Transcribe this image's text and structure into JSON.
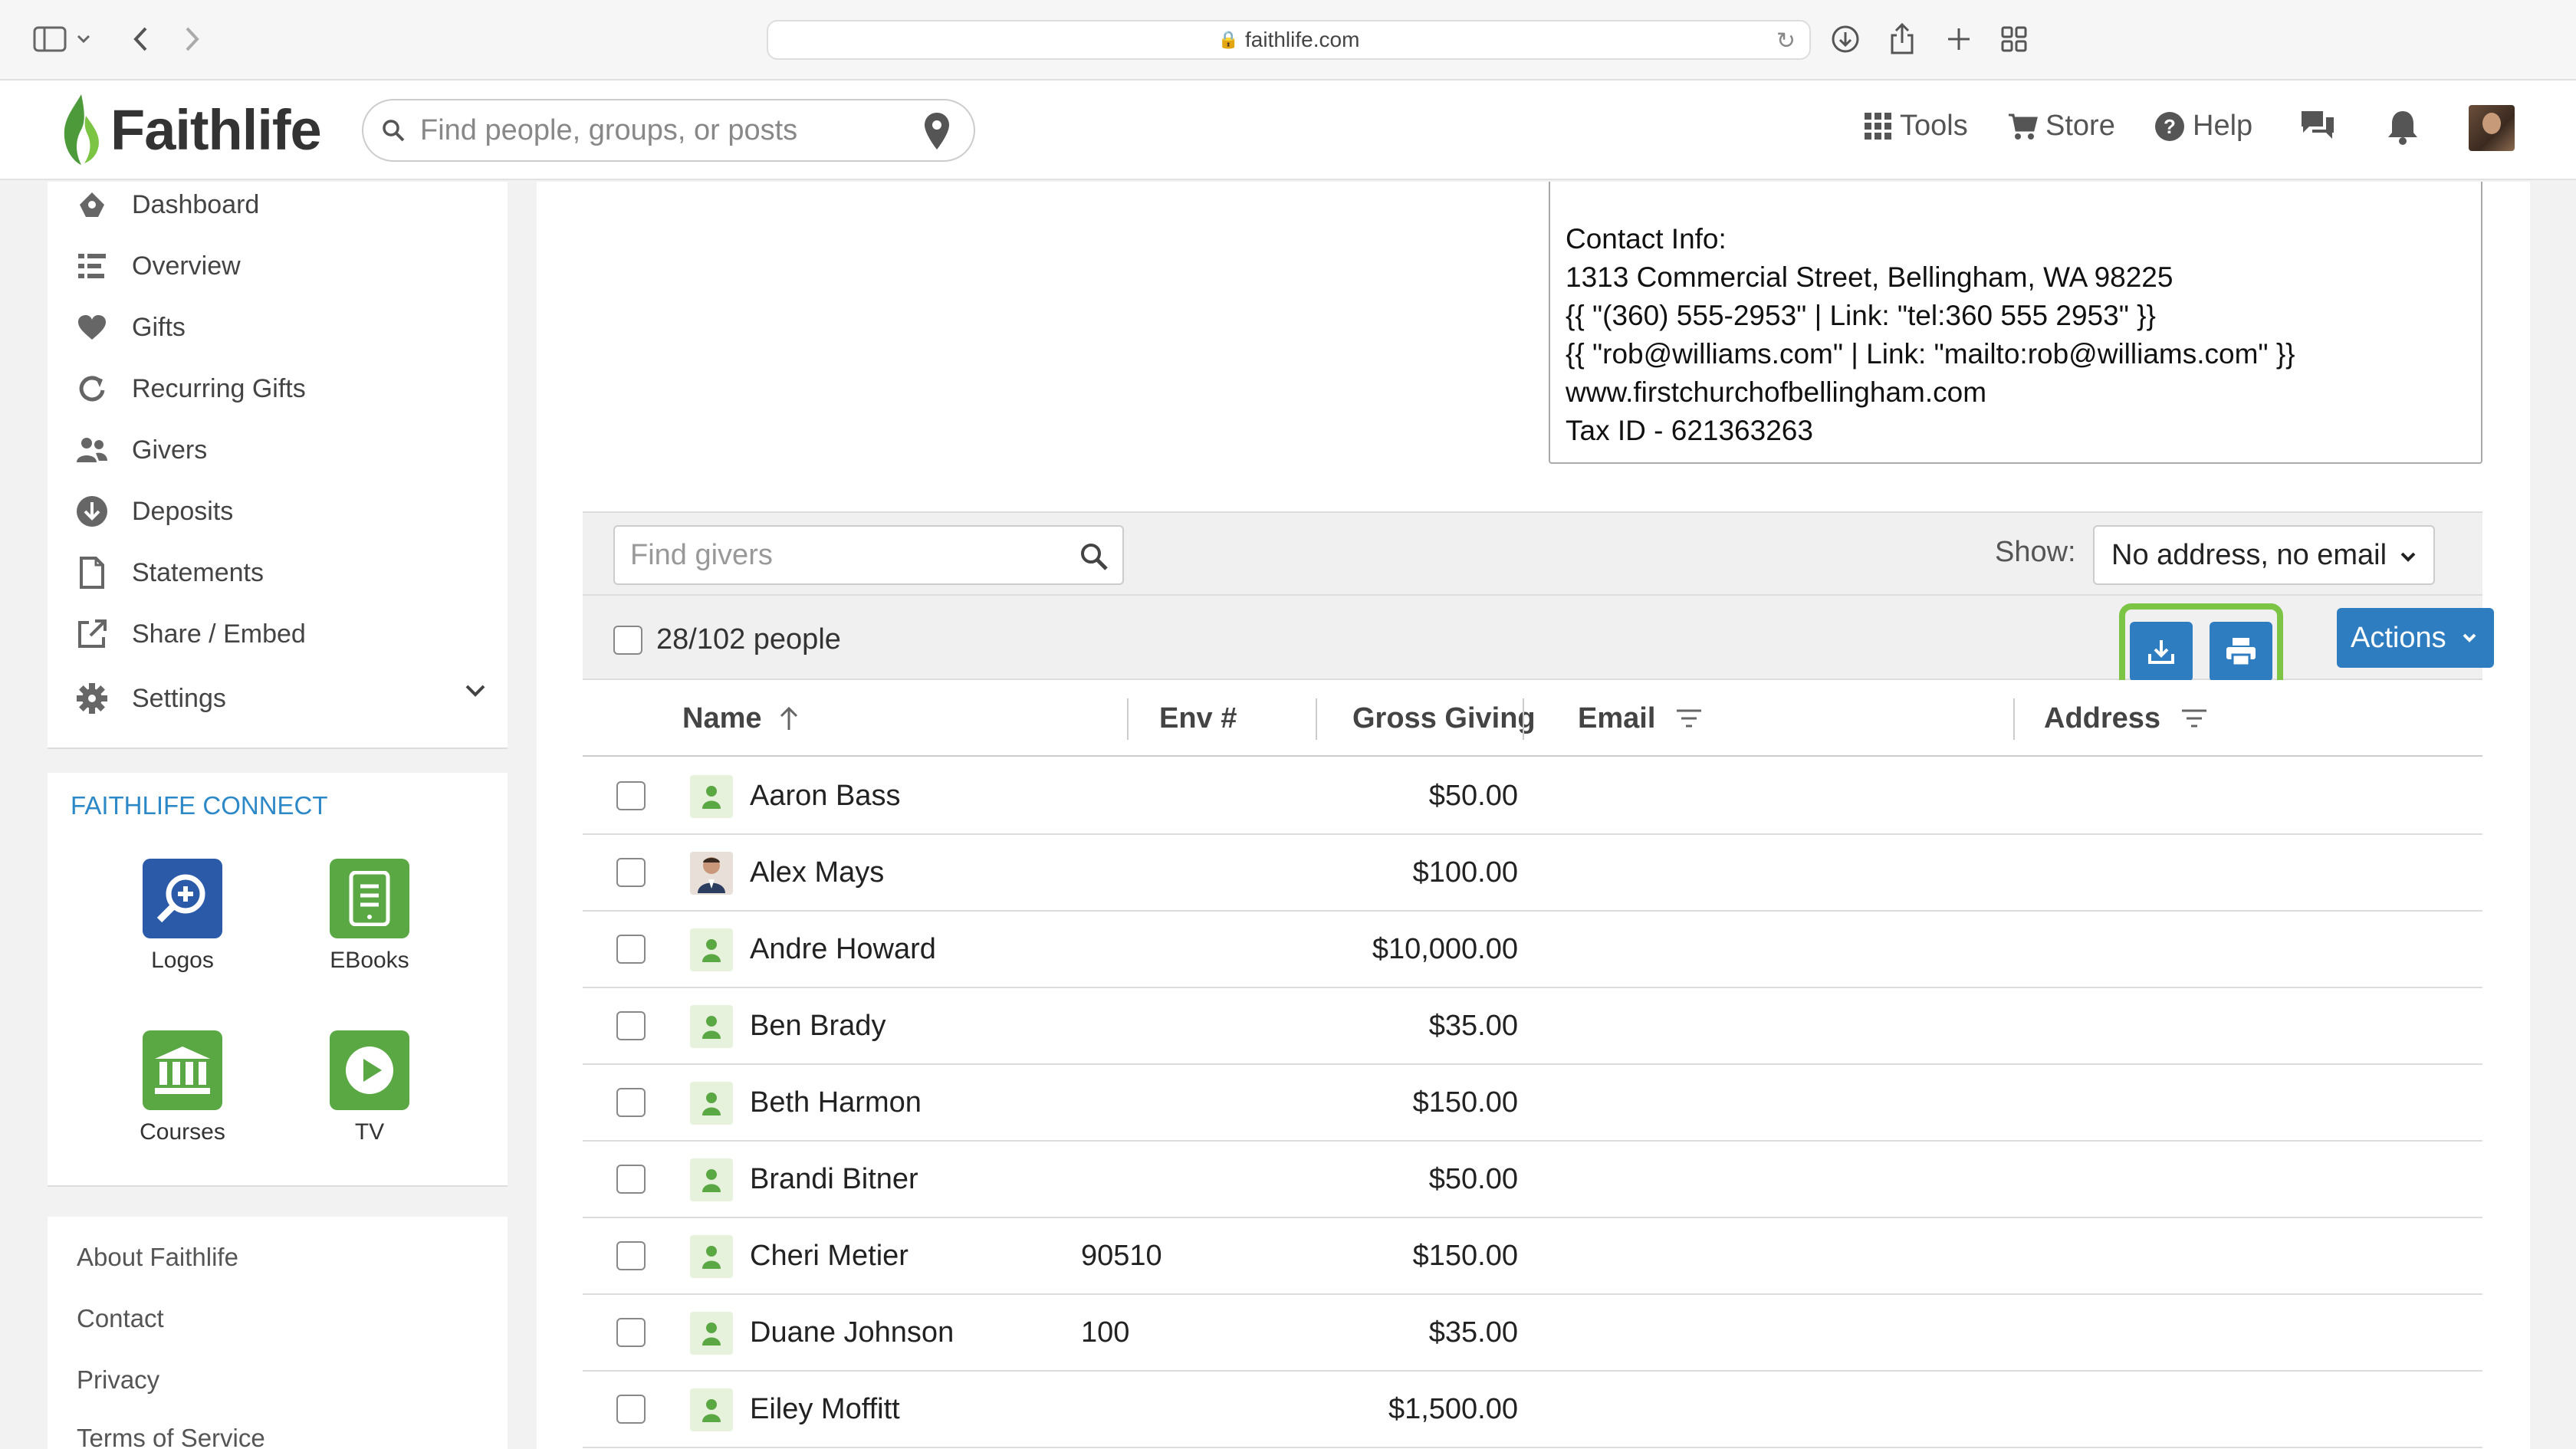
{
  "browser": {
    "url": "faithlife.com"
  },
  "header": {
    "logo_text": "Faithlife",
    "search_placeholder": "Find people, groups, or posts",
    "tools_label": "Tools",
    "store_label": "Store",
    "help_label": "Help"
  },
  "sidebar": {
    "items": [
      {
        "label": "Dashboard",
        "icon": "dashboard-icon"
      },
      {
        "label": "Overview",
        "icon": "overview-icon"
      },
      {
        "label": "Gifts",
        "icon": "heart-icon"
      },
      {
        "label": "Recurring Gifts",
        "icon": "recurring-icon"
      },
      {
        "label": "Givers",
        "icon": "people-icon"
      },
      {
        "label": "Deposits",
        "icon": "download-circle-icon"
      },
      {
        "label": "Statements",
        "icon": "document-icon"
      },
      {
        "label": "Share / Embed",
        "icon": "share-icon"
      },
      {
        "label": "Settings",
        "icon": "gear-icon"
      }
    ]
  },
  "connect": {
    "title": "FAITHLIFE CONNECT",
    "apps": [
      {
        "label": "Logos",
        "color": "#2a5aa8"
      },
      {
        "label": "EBooks",
        "color": "#5aa844"
      },
      {
        "label": "Courses",
        "color": "#5aa844"
      },
      {
        "label": "TV",
        "color": "#5aa844"
      }
    ]
  },
  "footer": {
    "links": [
      "About Faithlife",
      "Contact",
      "Privacy",
      "Terms of Service"
    ]
  },
  "contact": {
    "lines": [
      "Contact Info:",
      "1313 Commercial Street, Bellingham, WA 98225",
      "{{ \"(360) 555-2953\" | Link: \"tel:360 555 2953\" }}",
      "{{ \"rob@williams.com\" | Link: \"mailto:rob@williams.com\" }}",
      "www.firstchurchofbellingham.com",
      "Tax ID - 621363263"
    ]
  },
  "filters": {
    "find_placeholder": "Find givers",
    "show_label": "Show:",
    "show_value": "No address, no email",
    "selection_count": "28/102 people",
    "actions_label": "Actions"
  },
  "table": {
    "columns": [
      "Name",
      "Env #",
      "Gross Giving",
      "Email",
      "Address"
    ],
    "rows": [
      {
        "name": "Aaron Bass",
        "env": "",
        "gross": "$50.00",
        "photo": false
      },
      {
        "name": "Alex Mays",
        "env": "",
        "gross": "$100.00",
        "photo": true
      },
      {
        "name": "Andre Howard",
        "env": "",
        "gross": "$10,000.00",
        "photo": false
      },
      {
        "name": "Ben Brady",
        "env": "",
        "gross": "$35.00",
        "photo": false
      },
      {
        "name": "Beth Harmon",
        "env": "",
        "gross": "$150.00",
        "photo": false
      },
      {
        "name": "Brandi Bitner",
        "env": "",
        "gross": "$50.00",
        "photo": false
      },
      {
        "name": "Cheri Metier",
        "env": "90510",
        "gross": "$150.00",
        "photo": false
      },
      {
        "name": "Duane Johnson",
        "env": "100",
        "gross": "$35.00",
        "photo": false
      },
      {
        "name": "Eiley Moffitt",
        "env": "",
        "gross": "$1,500.00",
        "photo": false
      }
    ]
  },
  "colors": {
    "brand_green": "#5aa844",
    "action_blue": "#2f7dc1",
    "highlight_green": "#7cc444",
    "link_blue": "#2d88c7"
  }
}
